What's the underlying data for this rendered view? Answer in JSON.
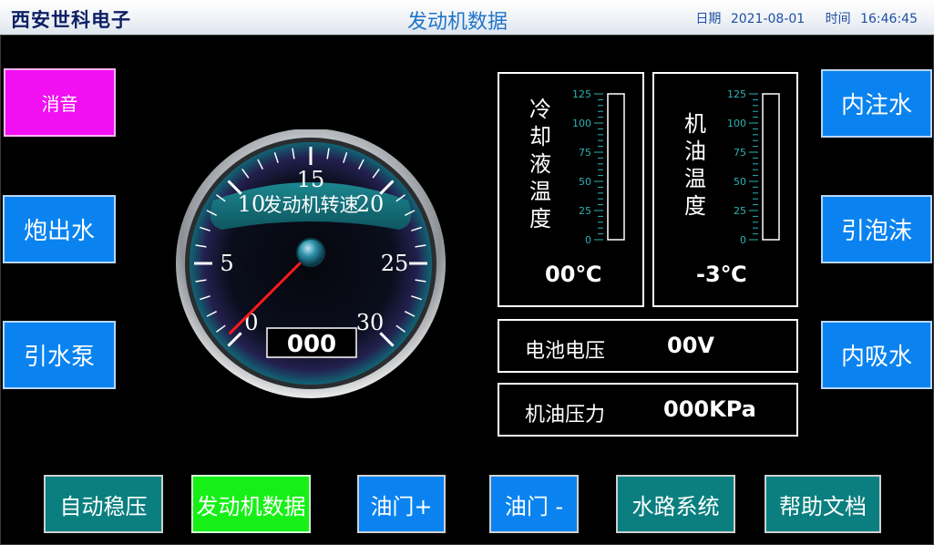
{
  "header": {
    "brand": "西安世科电子",
    "title": "发动机数据",
    "date_label": "日期",
    "date_value": "2021-08-01",
    "time_label": "时间",
    "time_value": "16:46:45"
  },
  "left_buttons": {
    "mute": "消音",
    "cannon_water": "炮出水",
    "priming_pump": "引水泵"
  },
  "right_buttons": {
    "inner_fill": "内注水",
    "foam": "引泡沫",
    "inner_suction": "内吸水"
  },
  "gauge": {
    "label": "发动机转速",
    "ticks": [
      "0",
      "5",
      "10",
      "15",
      "20",
      "25",
      "30"
    ],
    "value_display": "000",
    "needle_value": 0
  },
  "coolant": {
    "label_chars": [
      "冷",
      "却",
      "液",
      "温",
      "度"
    ],
    "scale": [
      "125",
      "100",
      "75",
      "50",
      "25",
      "0"
    ],
    "readout": "00℃"
  },
  "oil_temp": {
    "label_chars": [
      "机",
      "油",
      "温",
      "度"
    ],
    "scale": [
      "125",
      "100",
      "75",
      "50",
      "25",
      "0"
    ],
    "readout": "-3℃"
  },
  "battery": {
    "label": "电池电压",
    "value": "00V"
  },
  "oil_pressure": {
    "label": "机油压力",
    "value": "000KPa"
  },
  "bottom_buttons": {
    "auto_regulate": "自动稳压",
    "engine_data": "发动机数据",
    "throttle_up": "油门+",
    "throttle_down": "油门 -",
    "water_system": "水路系统",
    "help_docs": "帮助文档"
  },
  "colors": {
    "button_blue": "#0a83f0",
    "mute_magenta": "#f20ff2",
    "teal": "#0b7f7f",
    "active_green": "#16f016",
    "needle_red": "#ff1a1a"
  }
}
